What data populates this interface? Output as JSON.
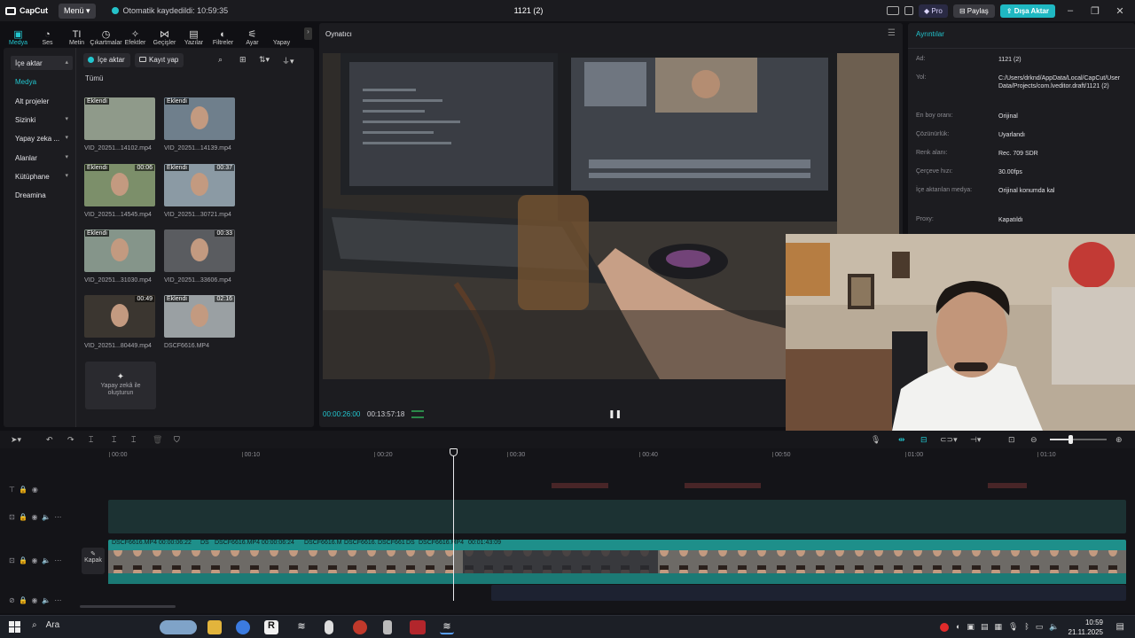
{
  "titlebar": {
    "logo_text": "CapCut",
    "menu_label": "Menü",
    "autosave_text": "Otomatik kaydedildi: 10:59:35",
    "project_title": "1121 (2)",
    "pro_label": "Pro",
    "share_label": "Paylaş",
    "export_label": "Dışa Aktar"
  },
  "toolbar": {
    "tools": [
      {
        "label": "Medya",
        "icon": "media-icon",
        "glyph": "▣"
      },
      {
        "label": "Ses",
        "icon": "audio-icon",
        "glyph": "◔"
      },
      {
        "label": "Metin",
        "icon": "text-icon",
        "glyph": "TI"
      },
      {
        "label": "Çıkartmalar",
        "icon": "sticker-icon",
        "glyph": "◷"
      },
      {
        "label": "Efektler",
        "icon": "effects-icon",
        "glyph": "✧"
      },
      {
        "label": "Geçişler",
        "icon": "transitions-icon",
        "glyph": "⋈"
      },
      {
        "label": "Yazılar",
        "icon": "captions-icon",
        "glyph": "▤"
      },
      {
        "label": "Filtreler",
        "icon": "filters-icon",
        "glyph": "◐"
      },
      {
        "label": "Ayar",
        "icon": "adjust-icon",
        "glyph": "⚟"
      },
      {
        "label": "Yapay",
        "icon": "ai-icon",
        "glyph": ""
      }
    ]
  },
  "leftnav": {
    "items": [
      {
        "label": "İçe aktar",
        "selected": true,
        "caret": "▴"
      },
      {
        "label": "Medya",
        "sub": true
      },
      {
        "label": "Alt projeler"
      },
      {
        "label": "Sizinki",
        "caret": "▾"
      },
      {
        "label": "Yapay zeka ...",
        "caret": "▾"
      },
      {
        "label": "Alanlar",
        "caret": "▾"
      },
      {
        "label": "Kütüphane",
        "caret": "▾"
      },
      {
        "label": "Dreamina"
      }
    ]
  },
  "media": {
    "import_label": "İçe aktar",
    "record_label": "Kayıt yap",
    "filter_label": "Tümü",
    "ai_create_label_1": "Yapay zekâ ile",
    "ai_create_label_2": "oluşturun",
    "items": [
      {
        "name": "VID_20251...14102.mp4",
        "badge": "Eklendi",
        "duration": ""
      },
      {
        "name": "VID_20251...14139.mp4",
        "badge": "Eklendi",
        "duration": ""
      },
      {
        "name": "VID_20251...14545.mp4",
        "badge": "Eklendi",
        "duration": "00:06"
      },
      {
        "name": "VID_20251...30721.mp4",
        "badge": "Eklendi",
        "duration": "00:37"
      },
      {
        "name": "VID_20251...31030.mp4",
        "badge": "Eklendi",
        "duration": ""
      },
      {
        "name": "VID_20251...33606.mp4",
        "badge": "",
        "duration": "00:33"
      },
      {
        "name": "VID_20251...80449.mp4",
        "badge": "",
        "duration": "00:49"
      },
      {
        "name": "DSCF6616.MP4",
        "badge": "Eklendi",
        "duration": "02:16"
      }
    ]
  },
  "player": {
    "title": "Oynatıcı",
    "current_time": "00:00:26:00",
    "total_time": "00:13:57:18"
  },
  "details": {
    "title": "Ayrıntılar",
    "rows": [
      {
        "key": "Ad:",
        "value": "1121 (2)"
      },
      {
        "key": "Yol:",
        "value": "C:/Users/drknd/AppData/Local/CapCut/User Data/Projects/com.lveditor.draft/1121 (2)"
      },
      {
        "key": "En boy oranı:",
        "value": "Orijinal"
      },
      {
        "key": "Çözünürlük:",
        "value": "Uyarlandı"
      },
      {
        "key": "Renk alanı:",
        "value": "Rec. 709 SDR"
      },
      {
        "key": "Çerçeve hızı:",
        "value": "30.00fps"
      },
      {
        "key": "İçe aktarılan medya:",
        "value": "Orijinal konumda kal"
      },
      {
        "key": "Proxy:",
        "value": "Kapatıldı"
      }
    ]
  },
  "timeline": {
    "ruler": [
      "00:00",
      "00:10",
      "00:20",
      "00:30",
      "00:40",
      "00:50",
      "01:00",
      "01:10"
    ],
    "cover_label": "Kapak",
    "main_clips": [
      {
        "label": "DSCF6616.MP4   00:00:06:22"
      },
      {
        "label": "DS"
      },
      {
        "label": "DSCF6616.MP4   00:00:06:24"
      },
      {
        "label": "DSCF6616.M"
      },
      {
        "label": "DSCF6616."
      },
      {
        "label": "DSCF661"
      },
      {
        "label": "DS"
      },
      {
        "label": "DSCF6616.MP4"
      },
      {
        "label": "00:01:43:09"
      }
    ]
  },
  "taskbar": {
    "search_label": "Ara",
    "time": "10:59",
    "date": "21.11.2025"
  },
  "colors": {
    "accent": "#22c6cf",
    "clip": "#1e8f8a",
    "bg": "#101014"
  }
}
